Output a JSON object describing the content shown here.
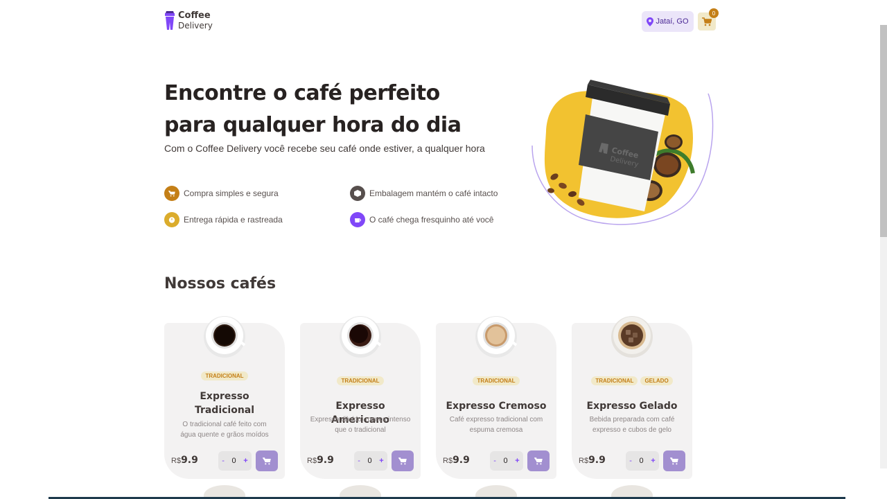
{
  "header": {
    "logo_top": "Coffee",
    "logo_bottom": "Delivery",
    "location": "Jataí, GO",
    "cart_count": "0"
  },
  "hero": {
    "title": "Encontre o café perfeito para qualquer hora do dia",
    "subtitle": "Com o Coffee Delivery você recebe seu café onde estiver, a qualquer hora",
    "features": [
      {
        "label": "Compra simples e segura",
        "color": "#C47F17",
        "icon": "cart-icon"
      },
      {
        "label": "Embalagem mantém o café intacto",
        "color": "#574F4D",
        "icon": "package-icon"
      },
      {
        "label": "Entrega rápida e rastreada",
        "color": "#DBAC2C",
        "icon": "timer-icon"
      },
      {
        "label": "O café chega fresquinho até você",
        "color": "#8047F8",
        "icon": "coffee-icon"
      }
    ]
  },
  "catalog": {
    "title": "Nossos cafés",
    "items": [
      {
        "tags": [
          "TRADICIONAL"
        ],
        "name": "Expresso Tradicional",
        "description": "O tradicional café feito com água quente e grãos moídos",
        "currency": "R$",
        "price": "9.9",
        "quantity": "0"
      },
      {
        "tags": [
          "TRADICIONAL"
        ],
        "name": "Expresso Americano",
        "description": "Expresso diluído, menos intenso que o tradicional",
        "currency": "R$",
        "price": "9.9",
        "quantity": "0"
      },
      {
        "tags": [
          "TRADICIONAL"
        ],
        "name": "Expresso Cremoso",
        "description": "Café expresso tradicional com espuma cremosa",
        "currency": "R$",
        "price": "9.9",
        "quantity": "0"
      },
      {
        "tags": [
          "TRADICIONAL",
          "GELADO"
        ],
        "name": "Expresso Gelado",
        "description": "Bebida preparada com café expresso e cubos de gelo",
        "currency": "R$",
        "price": "9.9",
        "quantity": "0"
      }
    ]
  },
  "colors": {
    "purple": "#8047F8",
    "purple_light": "#EBE5F9",
    "yellow": "#DBAC2C",
    "yellow_dark": "#C47F17",
    "yellow_light": "#F1E9C9",
    "card_bg": "#F3F2F2"
  }
}
